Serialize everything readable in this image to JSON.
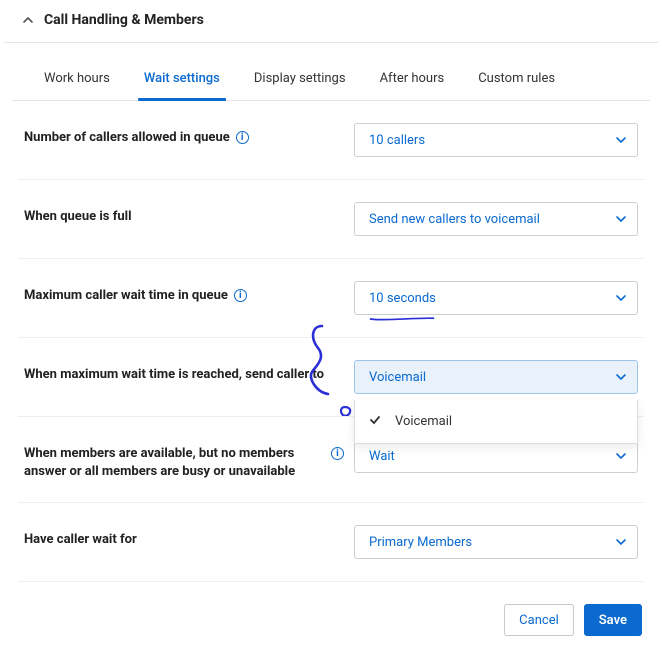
{
  "header": {
    "title": "Call Handling & Members"
  },
  "tabs": [
    {
      "label": "Work hours"
    },
    {
      "label": "Wait settings",
      "active": true
    },
    {
      "label": "Display settings"
    },
    {
      "label": "After hours"
    },
    {
      "label": "Custom rules"
    }
  ],
  "rows": {
    "callers_allowed": {
      "label": "Number of callers allowed in queue",
      "value": "10 callers"
    },
    "queue_full": {
      "label": "When queue is full",
      "value": "Send new callers to voicemail"
    },
    "max_wait": {
      "label": "Maximum caller wait time in queue",
      "value": "10 seconds"
    },
    "max_wait_action": {
      "label": "When maximum wait time is reached, send caller to",
      "value": "Voicemail",
      "options": [
        "Voicemail"
      ]
    },
    "no_answer": {
      "label": "When members are available, but no members answer or all members are busy or unavailable",
      "value": "Wait"
    },
    "wait_for": {
      "label": "Have caller wait for",
      "value": "Primary Members"
    }
  },
  "footer": {
    "cancel": "Cancel",
    "save": "Save"
  }
}
